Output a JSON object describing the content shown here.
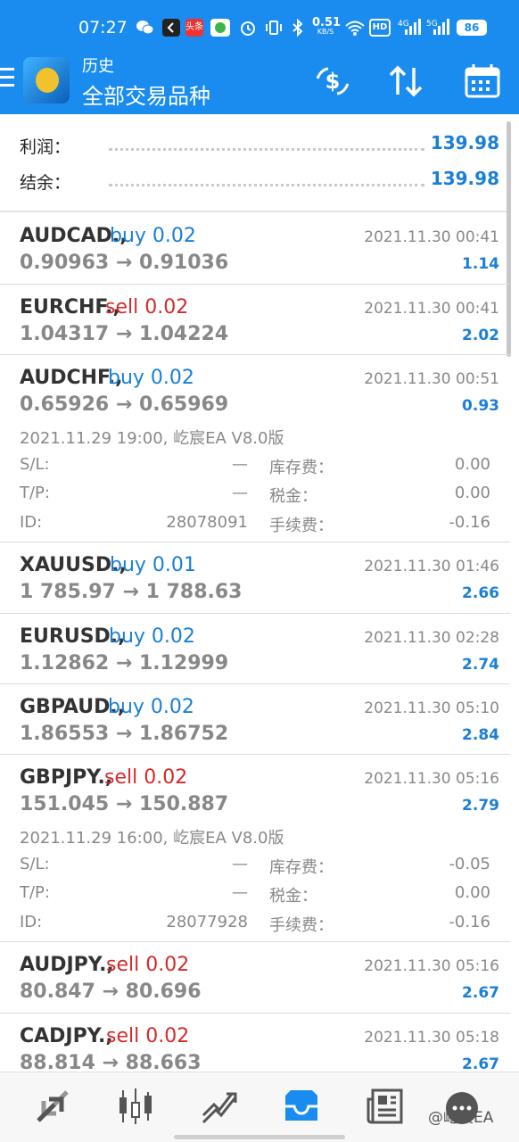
{
  "status_bar": {
    "time": "07:27",
    "network_speed": "0.51",
    "network_speed_unit": "KB/S",
    "battery": "86",
    "app_badge_text": "头条",
    "net_labels": [
      "HD",
      "4G",
      "5G"
    ]
  },
  "header": {
    "title": "历史",
    "subtitle": "全部交易品种",
    "icons": [
      "menu-icon",
      "currency-exchange-icon",
      "sort-icon",
      "calendar-icon"
    ]
  },
  "summary": {
    "profit_label": "利润：",
    "profit_value": "139.98",
    "balance_label": "结余：",
    "balance_value": "139.98"
  },
  "trades": [
    {
      "symbol": "AUDCAD.,",
      "side": "buy 0.02",
      "side_type": "buy",
      "date": "2021.11.30 00:41",
      "prices": "0.90963 → 0.91036",
      "profit": "1.14"
    },
    {
      "symbol": "EURCHF.,",
      "side": "sell 0.02",
      "side_type": "sell",
      "date": "2021.11.30 00:41",
      "prices": "1.04317 → 1.04224",
      "profit": "2.02"
    },
    {
      "symbol": "AUDCHF.,",
      "side": "buy 0.02",
      "side_type": "buy",
      "date": "2021.11.30 00:51",
      "prices": "0.65926 → 0.65969",
      "profit": "0.93",
      "details": {
        "open_line": "2021.11.29 19:00, 屹宸EA V8.0版",
        "sl_label": "S/L:",
        "sl_value": "—",
        "swap_label": "库存费：",
        "swap_value": "0.00",
        "tp_label": "T/P:",
        "tp_value": "—",
        "tax_label": "税金：",
        "tax_value": "0.00",
        "id_label": "ID:",
        "id_value": "28078091",
        "fee_label": "手续费：",
        "fee_value": "-0.16"
      }
    },
    {
      "symbol": "XAUUSD.,",
      "side": "buy 0.01",
      "side_type": "buy",
      "date": "2021.11.30 01:46",
      "prices": "1 785.97 → 1 788.63",
      "profit": "2.66"
    },
    {
      "symbol": "EURUSD.,",
      "side": "buy 0.02",
      "side_type": "buy",
      "date": "2021.11.30 02:28",
      "prices": "1.12862 → 1.12999",
      "profit": "2.74"
    },
    {
      "symbol": "GBPAUD.,",
      "side": "buy 0.02",
      "side_type": "buy",
      "date": "2021.11.30 05:10",
      "prices": "1.86553 → 1.86752",
      "profit": "2.84"
    },
    {
      "symbol": "GBPJPY.,",
      "side": "sell 0.02",
      "side_type": "sell",
      "date": "2021.11.30 05:16",
      "prices": "151.045 → 150.887",
      "profit": "2.79",
      "details": {
        "open_line": "2021.11.29 16:00, 屹宸EA V8.0版",
        "sl_label": "S/L:",
        "sl_value": "—",
        "swap_label": "库存费：",
        "swap_value": "-0.05",
        "tp_label": "T/P:",
        "tp_value": "—",
        "tax_label": "税金：",
        "tax_value": "0.00",
        "id_label": "ID:",
        "id_value": "28077928",
        "fee_label": "手续费：",
        "fee_value": "-0.16"
      }
    },
    {
      "symbol": "AUDJPY.,",
      "side": "sell 0.02",
      "side_type": "sell",
      "date": "2021.11.30 05:16",
      "prices": "80.847 → 80.696",
      "profit": "2.67"
    },
    {
      "symbol": "CADJPY.,",
      "side": "sell 0.02",
      "side_type": "sell",
      "date": "2021.11.30 05:18",
      "prices": "88.814 → 88.663",
      "profit": "2.67"
    }
  ],
  "bottom_nav": {
    "items": [
      "quotes-icon",
      "chart-icon",
      "trade-icon",
      "history-icon",
      "news-icon",
      "messages-icon"
    ],
    "active": "history-icon",
    "watermark": "@屹宸EA"
  },
  "colors": {
    "header_blue": "#1a8cf0",
    "buy_blue": "#1a7fd6",
    "sell_red": "#d42a2a",
    "profit_blue": "#1a7fd6"
  }
}
